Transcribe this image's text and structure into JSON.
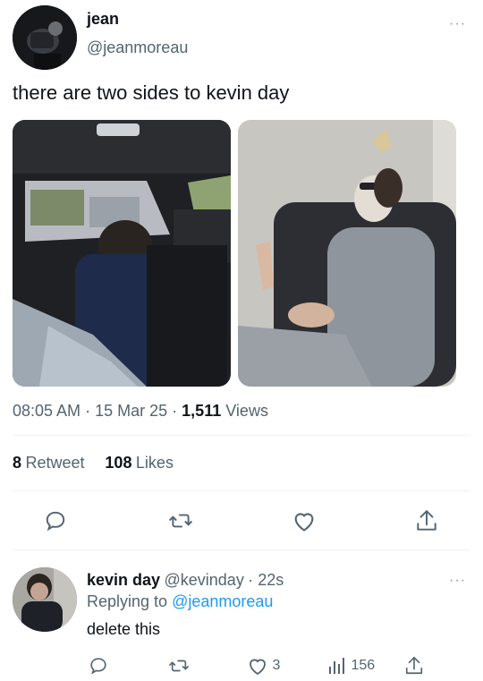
{
  "tweet": {
    "author_name": "jean",
    "author_handle": "@jeanmoreau",
    "text": "there are two sides to kevin day",
    "time": "08:05 AM",
    "date": "15 Mar 25",
    "views_count": "1,511",
    "views_label": "Views",
    "dot1": "·",
    "dot2": "·",
    "more": "···"
  },
  "stats": {
    "retweets_count": "8",
    "retweets_label": "Retweet",
    "likes_count": "108",
    "likes_label": "Likes"
  },
  "actions": [
    "reply-icon",
    "retweet-icon",
    "like-icon",
    "share-icon"
  ],
  "reply": {
    "author_name": "kevin day",
    "author_handle": "@kevinday",
    "time": "· 22s",
    "replying_prefix": "Replying to",
    "replying_to": "@jeanmoreau",
    "text": "delete this",
    "likes": "3",
    "views": "156",
    "more": "···"
  },
  "colors": {
    "link": "#1d9bf0",
    "secondary": "#536471",
    "divider": "#eff3f4"
  }
}
